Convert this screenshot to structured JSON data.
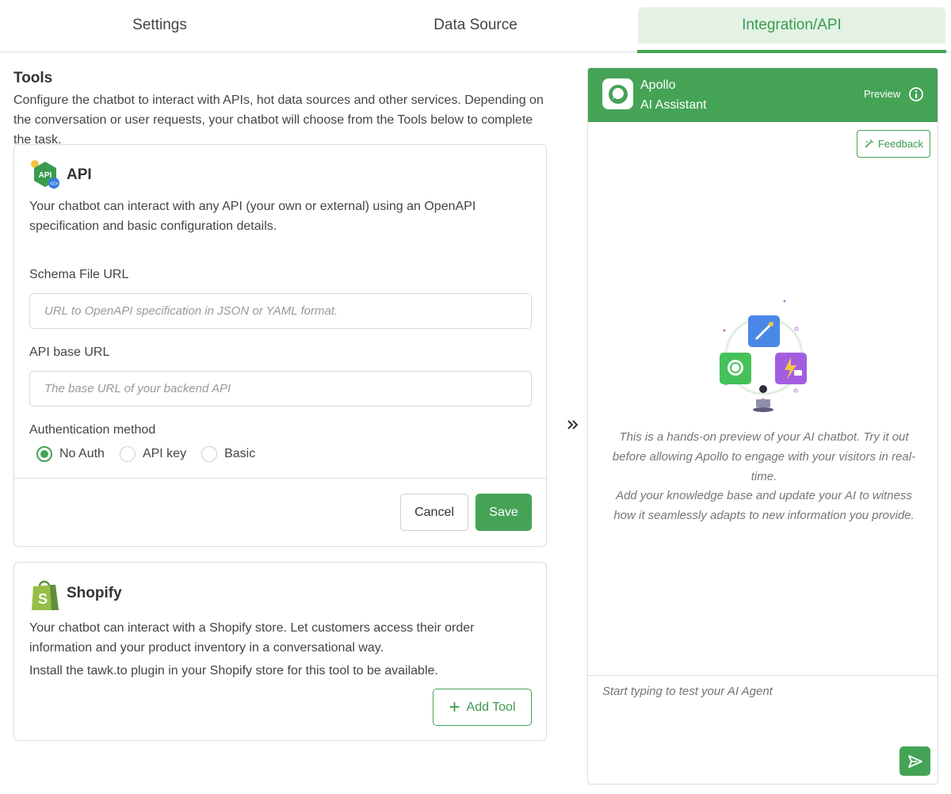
{
  "tabs": [
    {
      "label": "Settings",
      "active": false
    },
    {
      "label": "Data Source",
      "active": false
    },
    {
      "label": "Integration/API",
      "active": true
    }
  ],
  "colors": {
    "accent": "#45a356",
    "accent_light": "#e3f2e5",
    "border": "#dcdcdc"
  },
  "tools": {
    "title": "Tools",
    "description": "Configure the chatbot to interact with APIs, hot data sources and other services. Depending on the conversation or user requests, your chatbot will choose from the Tools below to complete the task."
  },
  "api_card": {
    "icon": "api-icon",
    "title": "API",
    "description": "Your chatbot can interact with any API (your own or external) using an OpenAPI specification and basic configuration details.",
    "schema_label": "Schema File URL",
    "schema_placeholder": "URL to OpenAPI specification in JSON or YAML format.",
    "base_label": "API base URL",
    "base_placeholder": "The base URL of your backend API",
    "auth_label": "Authentication method",
    "auth_options": [
      "No Auth",
      "API key",
      "Basic"
    ],
    "auth_selected": "No Auth",
    "cancel_label": "Cancel",
    "save_label": "Save"
  },
  "shopify_card": {
    "icon": "shopify-bag-icon",
    "title": "Shopify",
    "description": "Your chatbot can interact with a Shopify store. Let customers access their order information and your product inventory in a conversational way.",
    "install_note": "Install the tawk.to plugin in your Shopify store for this tool to be available.",
    "add_label": "Add Tool"
  },
  "chat": {
    "name": "Apollo",
    "subtitle": "AI Assistant",
    "preview_label": "Preview",
    "feedback_label": "Feedback",
    "intro_1": "This is a hands-on preview of your AI chatbot. Try it out before allowing Apollo to engage with your visitors in real-time.",
    "intro_2": "Add your knowledge base and update your AI to witness how it seamlessly adapts to new information you provide.",
    "input_placeholder": "Start typing to test your AI Agent"
  }
}
